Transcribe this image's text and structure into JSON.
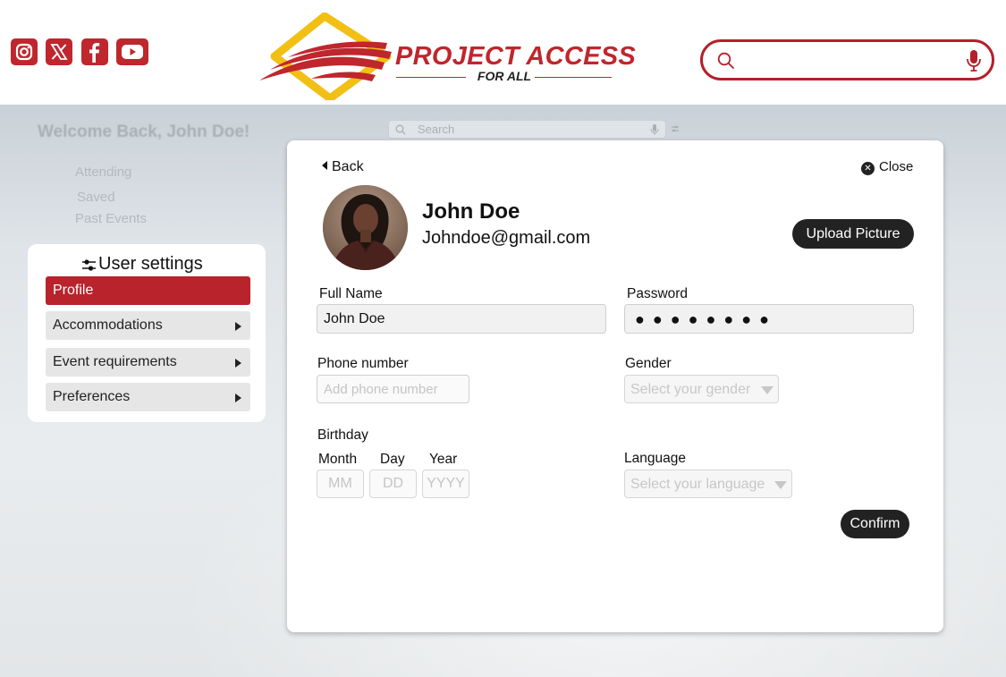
{
  "header": {
    "brand_title": "PROJECT ACCESS",
    "brand_subtitle": "FOR ALL",
    "social_icons": [
      "instagram-icon",
      "x-icon",
      "facebook-icon",
      "youtube-icon"
    ],
    "search": {
      "placeholder": "",
      "value": ""
    },
    "brand_color": "#c0262d",
    "logo_accent": "#f2bf14"
  },
  "background_page": {
    "welcome": "Welcome Back, John Doe!",
    "nav_items": [
      "Attending",
      "Saved",
      "Past Events"
    ],
    "search_placeholder": "Search"
  },
  "settings": {
    "title": "User settings",
    "items": [
      {
        "label": "Profile",
        "active": true
      },
      {
        "label": "Accommodations",
        "active": false
      },
      {
        "label": "Event requirements",
        "active": false
      },
      {
        "label": "Preferences",
        "active": false
      }
    ]
  },
  "profile": {
    "back_label": "Back",
    "close_label": "Close",
    "name": "John Doe",
    "email": "Johndoe@gmail.com",
    "upload_label": "Upload Picture",
    "full_name_label": "Full Name",
    "full_name_value": "John Doe",
    "password_label": "Password",
    "password_mask": "●●●●●●●●",
    "phone_label": "Phone number",
    "phone_placeholder": "Add phone number",
    "gender_label": "Gender",
    "gender_placeholder": "Select your gender",
    "birthday_label": "Birthday",
    "month_label": "Month",
    "day_label": "Day",
    "year_label": "Year",
    "month_placeholder": "MM",
    "day_placeholder": "DD",
    "year_placeholder": "YYYY",
    "language_label": "Language",
    "language_placeholder": "Select your language",
    "confirm_label": "Confirm"
  }
}
